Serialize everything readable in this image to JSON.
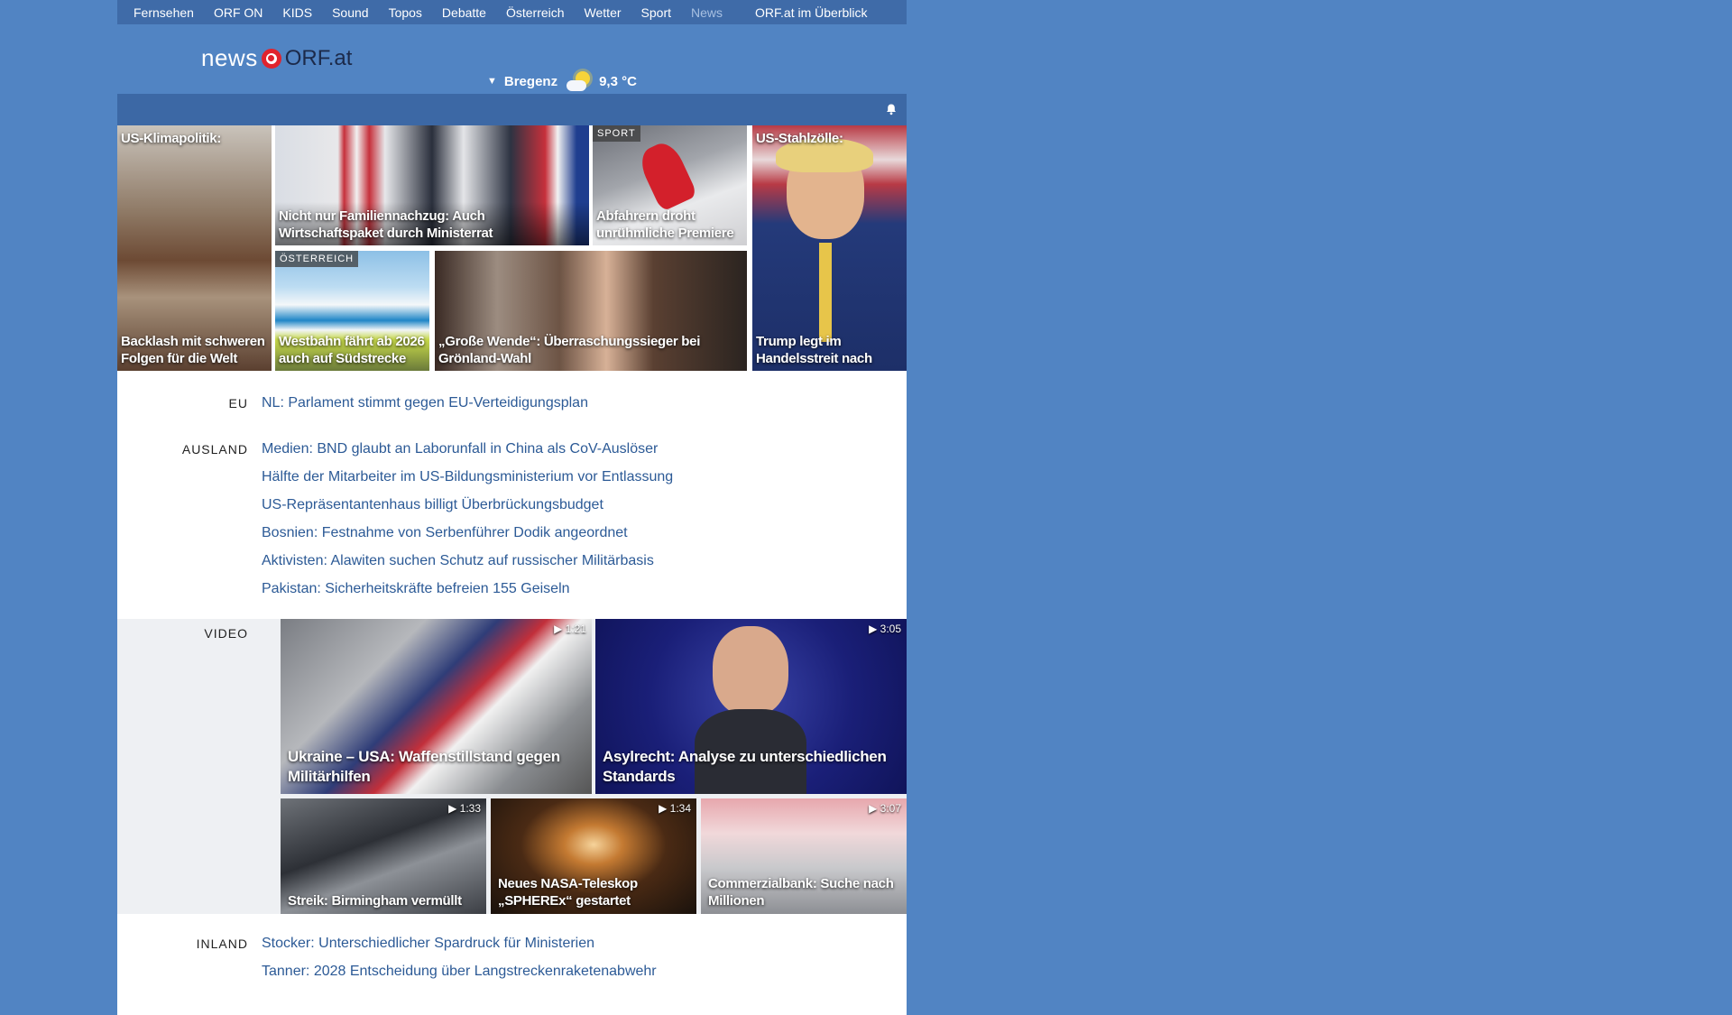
{
  "topnav": {
    "items": [
      "Fernsehen",
      "ORF ON",
      "KIDS",
      "Sound",
      "Topos",
      "Debatte",
      "Österreich",
      "Wetter",
      "Sport",
      "News"
    ],
    "overview": "ORF.at im Überblick"
  },
  "header": {
    "logo_news": "news",
    "logo_orf": "ORF.at",
    "weather_city": "Bregenz",
    "weather_temp": "9,3 °C"
  },
  "hero": {
    "klima_top": "US-Klimapolitik:",
    "klima_cap": "Backlash mit schweren Folgen für die Welt",
    "famil_cap": "Nicht nur Familiennachzug: Auch Wirtschaftspaket durch Ministerrat",
    "sport_badge": "SPORT",
    "sport_cap": "Abfahrern droht unrühmliche Premiere",
    "stahl_top": "US-Stahlzölle:",
    "stahl_cap": "Trump legt im Handelsstreit nach",
    "oest_badge": "ÖSTERREICH",
    "west_cap": "Westbahn fährt ab 2026 auch auf Südstrecke",
    "groen_cap": "„Große Wende“: Überraschungssieger bei Grönland-Wahl"
  },
  "sections": {
    "eu_label": "EU",
    "eu_items": [
      "NL: Parlament stimmt gegen EU-Verteidigungsplan"
    ],
    "ausland_label": "AUSLAND",
    "ausland_items": [
      "Medien: BND glaubt an Laborunfall in China als CoV-Auslöser",
      "Hälfte der Mitarbeiter im US-Bildungsministerium vor Entlassung",
      "US-Repräsentantenhaus billigt Überbrückungsbudget",
      "Bosnien: Festnahme von Serbenführer Dodik angeordnet",
      "Aktivisten: Alawiten suchen Schutz auf russischer Militärbasis",
      "Pakistan: Sicherheitskräfte befreien 155 Geiseln"
    ],
    "inland_label": "INLAND",
    "inland_items": [
      "Stocker: Unterschiedlicher Spardruck für Ministerien",
      "Tanner: 2028 Entscheidung über Langstreckenraketenabwehr"
    ]
  },
  "video": {
    "label": "VIDEO",
    "items": [
      {
        "duration": "1:21",
        "caption": "Ukraine – USA: Waffenstillstand gegen Militärhilfen"
      },
      {
        "duration": "3:05",
        "caption": "Asylrecht: Analyse zu unterschiedlichen Standards"
      },
      {
        "duration": "1:33",
        "caption": "Streik: Birmingham vermüllt"
      },
      {
        "duration": "1:34",
        "caption": "Neues NASA-Teleskop „SPHEREx“ gestartet"
      },
      {
        "duration": "3:07",
        "caption": "Commerzialbank: Suche nach Millionen"
      }
    ]
  },
  "colors": {
    "background": "#5184c3",
    "nav": "#3f6ba8",
    "link": "#2c5a96",
    "orf_red": "#e0232d"
  }
}
